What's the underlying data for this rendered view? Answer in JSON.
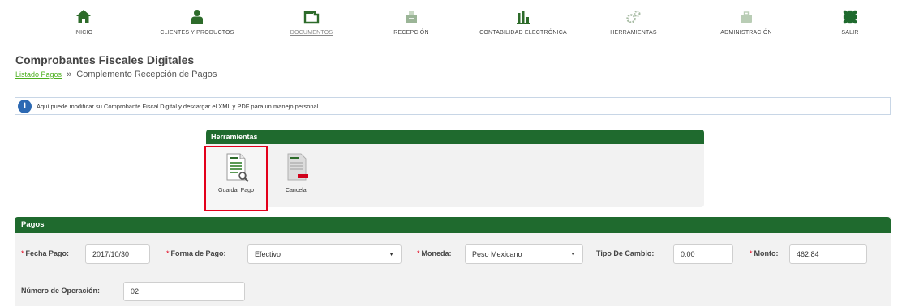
{
  "nav": {
    "items": [
      {
        "label": "INICIO",
        "icon": "home-icon"
      },
      {
        "label": "CLIENTES Y PRODUCTOS",
        "icon": "user-icon"
      },
      {
        "label": "DOCUMENTOS",
        "icon": "folder-icon"
      },
      {
        "label": "RECEPCIÓN",
        "icon": "inbox-icon"
      },
      {
        "label": "CONTABILIDAD ELECTRÓNICA",
        "icon": "bar-chart-icon"
      },
      {
        "label": "HERRAMIENTAS",
        "icon": "gears-icon"
      },
      {
        "label": "ADMINISTRACIÓN",
        "icon": "briefcase-icon"
      },
      {
        "label": "SALIR",
        "icon": "puzzle-exit-icon"
      }
    ],
    "active_index": 2
  },
  "page": {
    "title": "Comprobantes Fiscales Digitales",
    "breadcrumb_link": "Listado Pagos",
    "breadcrumb_sep": "»",
    "breadcrumb_current": "Complemento Recepción de Pagos"
  },
  "info": {
    "icon_glyph": "i",
    "text": "Aquí puede modificar su Comprobante Fiscal Digital y descargar el XML y PDF para un manejo personal."
  },
  "tools": {
    "title": "Herramientas",
    "save_label": "Guardar Pago",
    "cancel_label": "Cancelar"
  },
  "pagos": {
    "title": "Pagos",
    "required_mark": "*",
    "fecha_label": "Fecha Pago:",
    "fecha_value": "2017/10/30",
    "forma_label": "Forma de Pago:",
    "forma_value": "Efectivo",
    "moneda_label": "Moneda:",
    "moneda_value": "Peso Mexicano",
    "tipo_cambio_label": "Tipo De Cambio:",
    "tipo_cambio_value": "0.00",
    "monto_label": "Monto:",
    "monto_value": "462.84",
    "operacion_label": "Número de Operación:",
    "operacion_value": "02"
  },
  "colors": {
    "header_green": "#1f6a2e",
    "link_green": "#4caf1e",
    "highlight_red": "#e3001b",
    "info_blue": "#2c69b3"
  }
}
